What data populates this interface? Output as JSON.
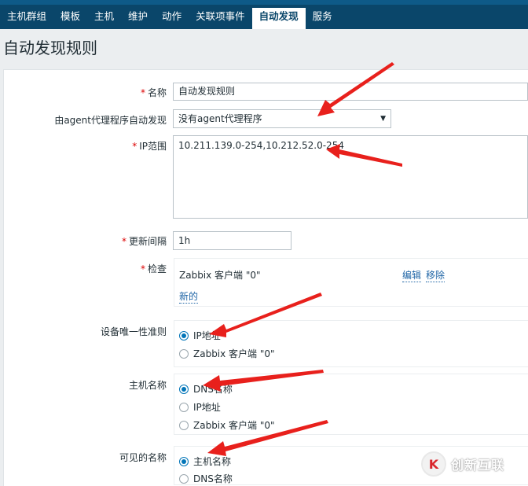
{
  "nav": {
    "items": [
      "主机群组",
      "模板",
      "主机",
      "维护",
      "动作",
      "关联项事件",
      "自动发现",
      "服务"
    ],
    "active_index": 6
  },
  "page": {
    "title": "自动发现规则"
  },
  "form": {
    "name_label": "名称",
    "name_value": "自动发现规则",
    "proxy_label": "由agent代理程序自动发现",
    "proxy_value": "没有agent代理程序",
    "ip_label": "IP范围",
    "ip_value": "10.211.139.0-254,10.212.52.0-254",
    "interval_label": "更新间隔",
    "interval_value": "1h",
    "checks_label": "检查",
    "check_item": "Zabbix 客户端 \"0\"",
    "edit_link": "编辑",
    "remove_link": "移除",
    "new_link": "新的",
    "uniqueness_label": "设备唯一性准则",
    "uniqueness_options": [
      "IP地址",
      "Zabbix 客户端 \"0\""
    ],
    "uniqueness_selected": 0,
    "hostname_label": "主机名称",
    "hostname_options": [
      "DNS名称",
      "IP地址",
      "Zabbix 客户端 \"0\""
    ],
    "hostname_selected": 0,
    "visible_label": "可见的名称",
    "visible_options": [
      "主机名称",
      "DNS名称"
    ],
    "visible_selected": 0
  },
  "watermark": {
    "text": "创新互联",
    "logo": "K"
  },
  "colors": {
    "topbar": "#0a466a",
    "accent": "#0275b8",
    "arrow": "#e8201c"
  }
}
